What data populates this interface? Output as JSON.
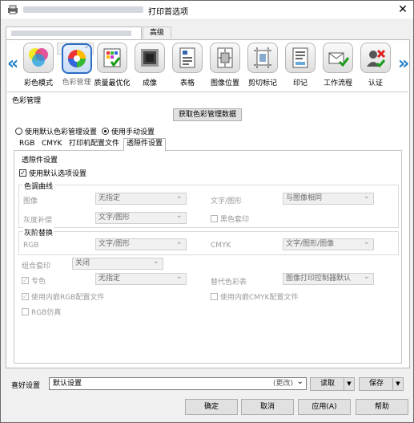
{
  "window": {
    "title": "打印首选项",
    "close": "✕"
  },
  "tabs": {
    "advanced": "高级"
  },
  "toolbar": {
    "left_arrow": "«",
    "right_arrow": "»",
    "items": [
      {
        "label": "彩色模式",
        "icon": "color-mode-icon"
      },
      {
        "label": "色彩管理",
        "icon": "color-management-icon"
      },
      {
        "label": "质量最优化",
        "icon": "quality-optimize-icon"
      },
      {
        "label": "成像",
        "icon": "imaging-icon"
      },
      {
        "label": "表格",
        "icon": "form-icon"
      },
      {
        "label": "图像位置",
        "icon": "image-position-icon"
      },
      {
        "label": "剪切标记",
        "icon": "crop-marks-icon"
      },
      {
        "label": "印记",
        "icon": "stamp-icon"
      },
      {
        "label": "工作流程",
        "icon": "workflow-icon"
      },
      {
        "label": "认证",
        "icon": "authentication-icon"
      }
    ]
  },
  "color_management": {
    "section_label": "色彩管理",
    "fetch_button": "获取色彩管理数据",
    "radio_default": "使用默认色彩管理设置",
    "radio_manual": "使用手动设置",
    "inner_tabs": [
      "RGB",
      "CMYK",
      "打印机配置文件",
      "透隙件设置"
    ],
    "group_label": "透隙件设置",
    "use_default_option": "使用默认选项设置",
    "tone_curve": {
      "label": "色调曲线",
      "image_label": "图像",
      "image_value": "无指定",
      "text_label": "文字/图形",
      "text_value": "与图像相同",
      "gray_label": "灰度补偿",
      "gray_value": "文字/图形",
      "black_overprint": "黑色套印"
    },
    "gray_replace": {
      "label": "灰阶替换",
      "rgb_label": "RGB",
      "rgb_value": "文字/图形",
      "cmyk_label": "CMYK",
      "cmyk_value": "文字/图形/图像"
    },
    "composite_overprint_label": "组合套印",
    "composite_overprint_value": "关闭",
    "spot_label": "专色",
    "spot_value": "无指定",
    "alt_table_label": "替代色彩表",
    "alt_table_value": "图像打印控制器默认",
    "embedded_rgb": "使用内嵌RGB配置文件",
    "embedded_cmyk": "使用内嵌CMYK配置文件",
    "rgb_emulation": "RGB仿真"
  },
  "favorites": {
    "label": "喜好设置",
    "value": "默认设置",
    "changed": "(更改)",
    "load": "读取",
    "save": "保存"
  },
  "footer": {
    "ok": "确定",
    "cancel": "取消",
    "apply": "应用(A)",
    "help": "帮助"
  }
}
